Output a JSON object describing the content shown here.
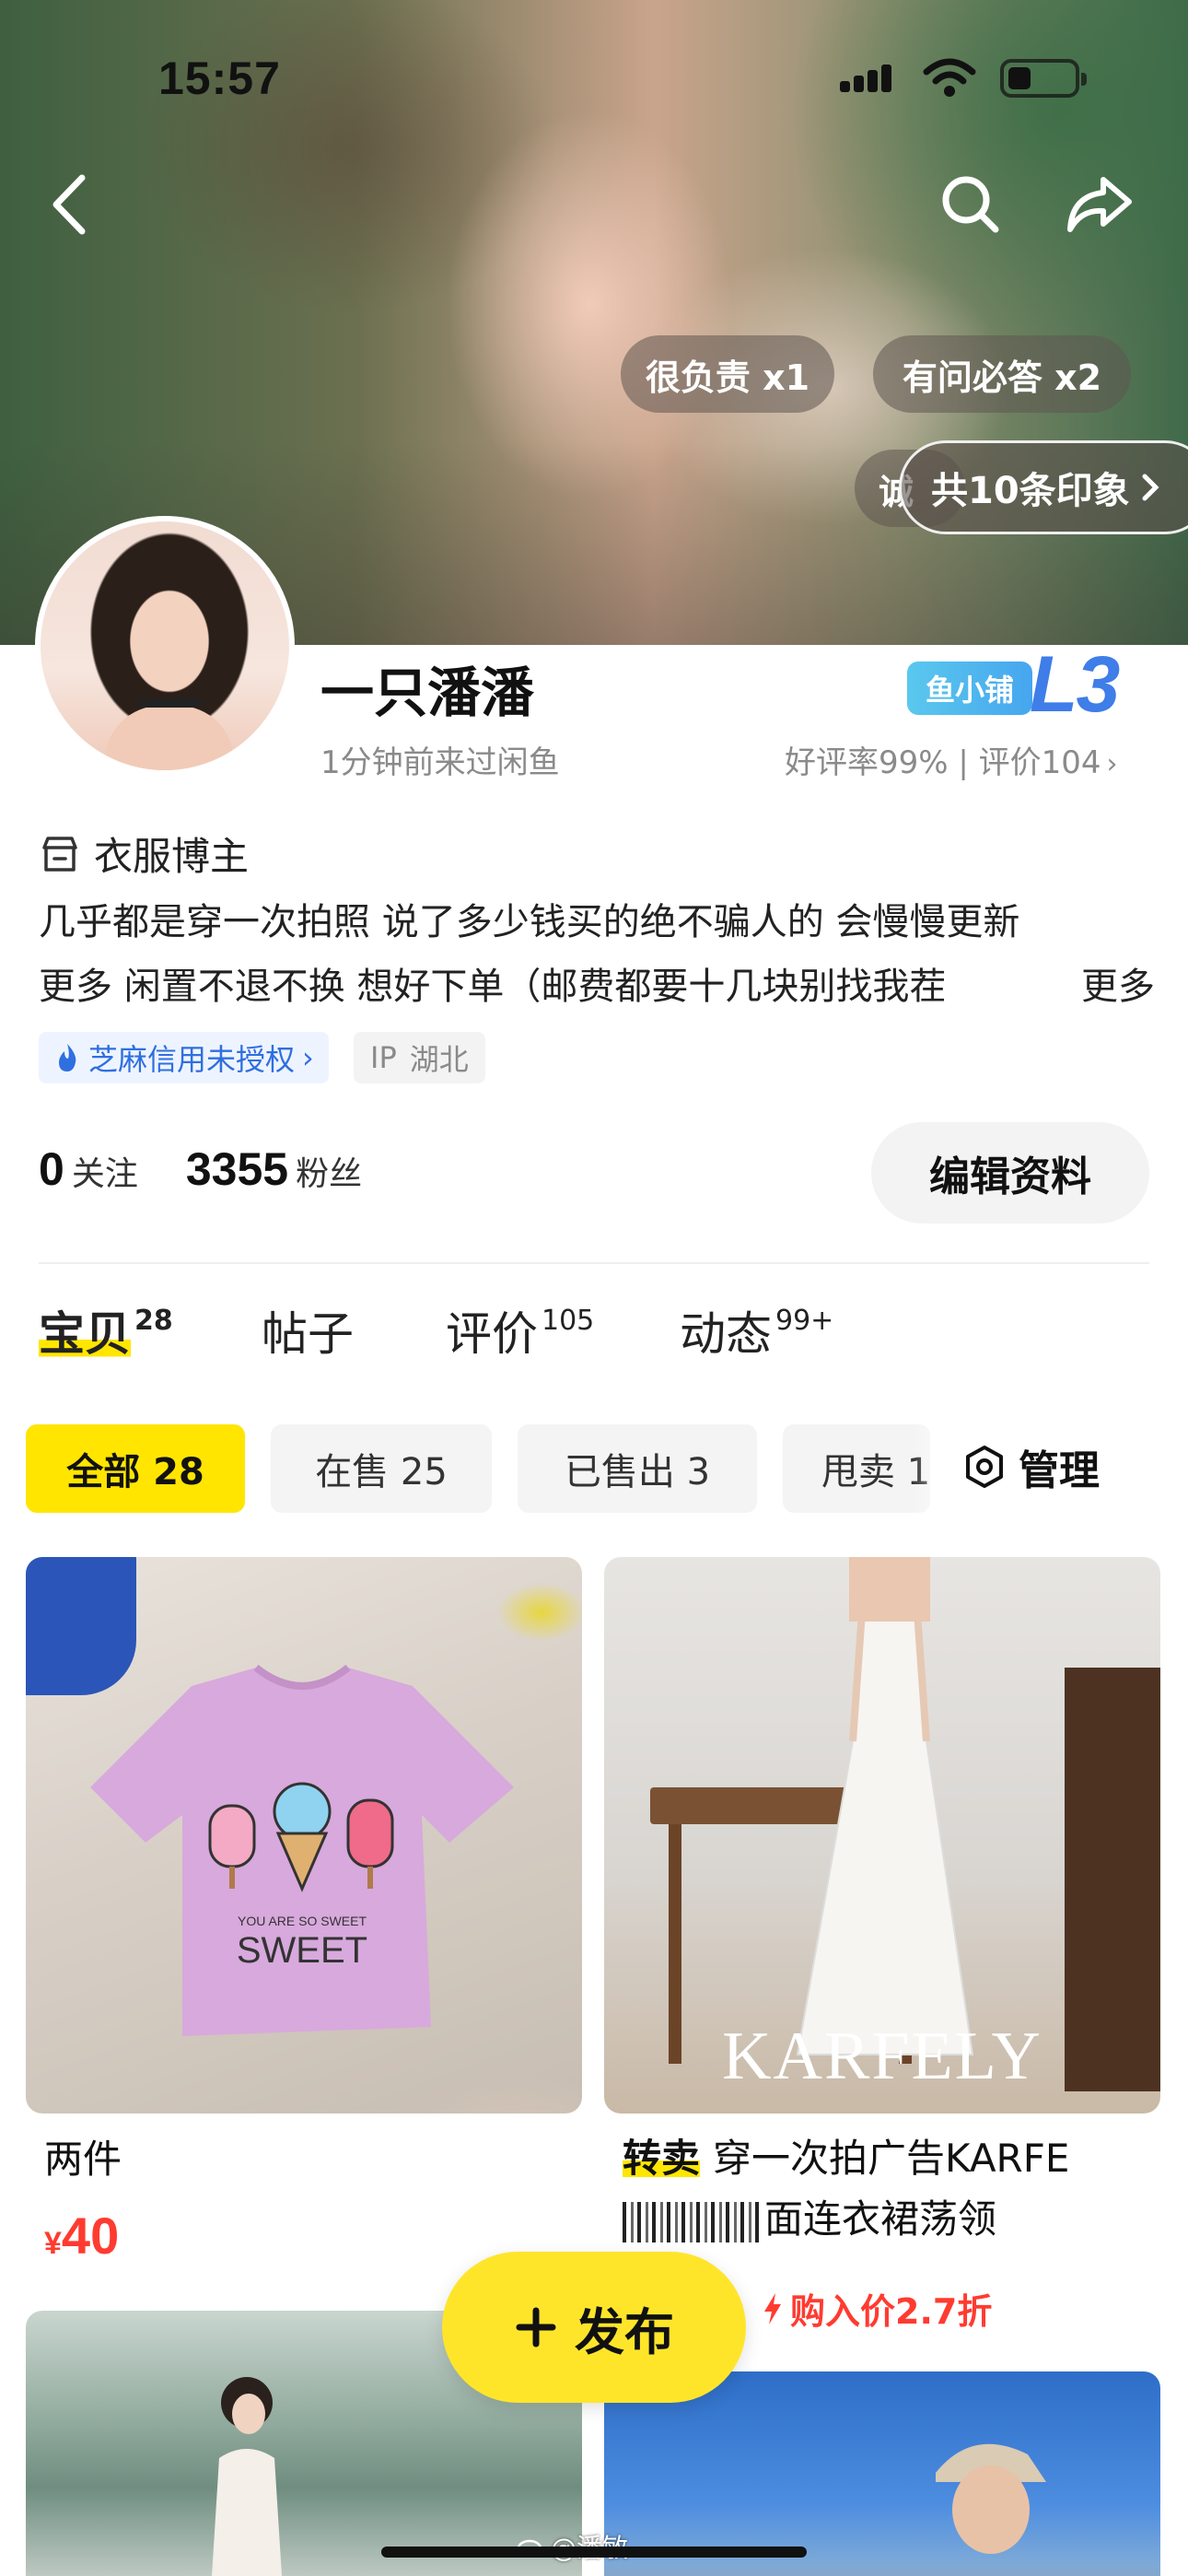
{
  "status_bar": {
    "time": "15:57"
  },
  "header": {
    "back_icon": "chevron-left-icon",
    "search_icon": "search-icon",
    "share_icon": "share-icon",
    "chips": [
      "很负责 x1",
      "有问必答 x2",
      "诚"
    ],
    "impressions_label": "共10条印象"
  },
  "profile": {
    "username": "一只潘潘",
    "last_seen": "1分钟前来过闲鱼",
    "shop_badge": "鱼小铺",
    "level": "L3",
    "rating_text": "好评率99% | 评价104",
    "tag": "衣服博主",
    "bio_line1": "几乎都是穿一次拍照 说了多少钱买的绝不骗人的 会慢慢更新",
    "bio_line2": "更多 闲置不退不换 想好下单（邮费都要十几块别找我茬",
    "bio_more": "更多",
    "sesame_label": "芝麻信用未授权",
    "ip_prefix": "IP",
    "ip_location": "湖北"
  },
  "stats": {
    "following_count": "0",
    "following_label": "关注",
    "fans_count": "3355",
    "fans_label": "粉丝",
    "edit_label": "编辑资料"
  },
  "tabs": [
    {
      "label": "宝贝",
      "count": "28"
    },
    {
      "label": "帖子",
      "count": ""
    },
    {
      "label": "评价",
      "count": "105"
    },
    {
      "label": "动态",
      "count": "99+"
    }
  ],
  "filters": [
    {
      "label": "全部 28"
    },
    {
      "label": "在售 25"
    },
    {
      "label": "已售出 3"
    },
    {
      "label": "甩卖 1"
    }
  ],
  "manage_label": "管理",
  "products": [
    {
      "title": "两件",
      "price_symbol": "¥",
      "price": "40"
    },
    {
      "tag": "转卖",
      "title_line1": "穿一次拍广告KARFE",
      "title_line2": "面连衣裙荡领",
      "buy_price": "购入价2.7折",
      "image_text": "KARFELY"
    }
  ],
  "image_text": {
    "shirt": "YOU ARE SO SWEET"
  },
  "publish_label": "发布",
  "watermark": "@潘敏-",
  "colors": {
    "accent_yellow": "#ffe500",
    "price_red": "#ff3b30",
    "level_blue": "#3f7de8"
  }
}
